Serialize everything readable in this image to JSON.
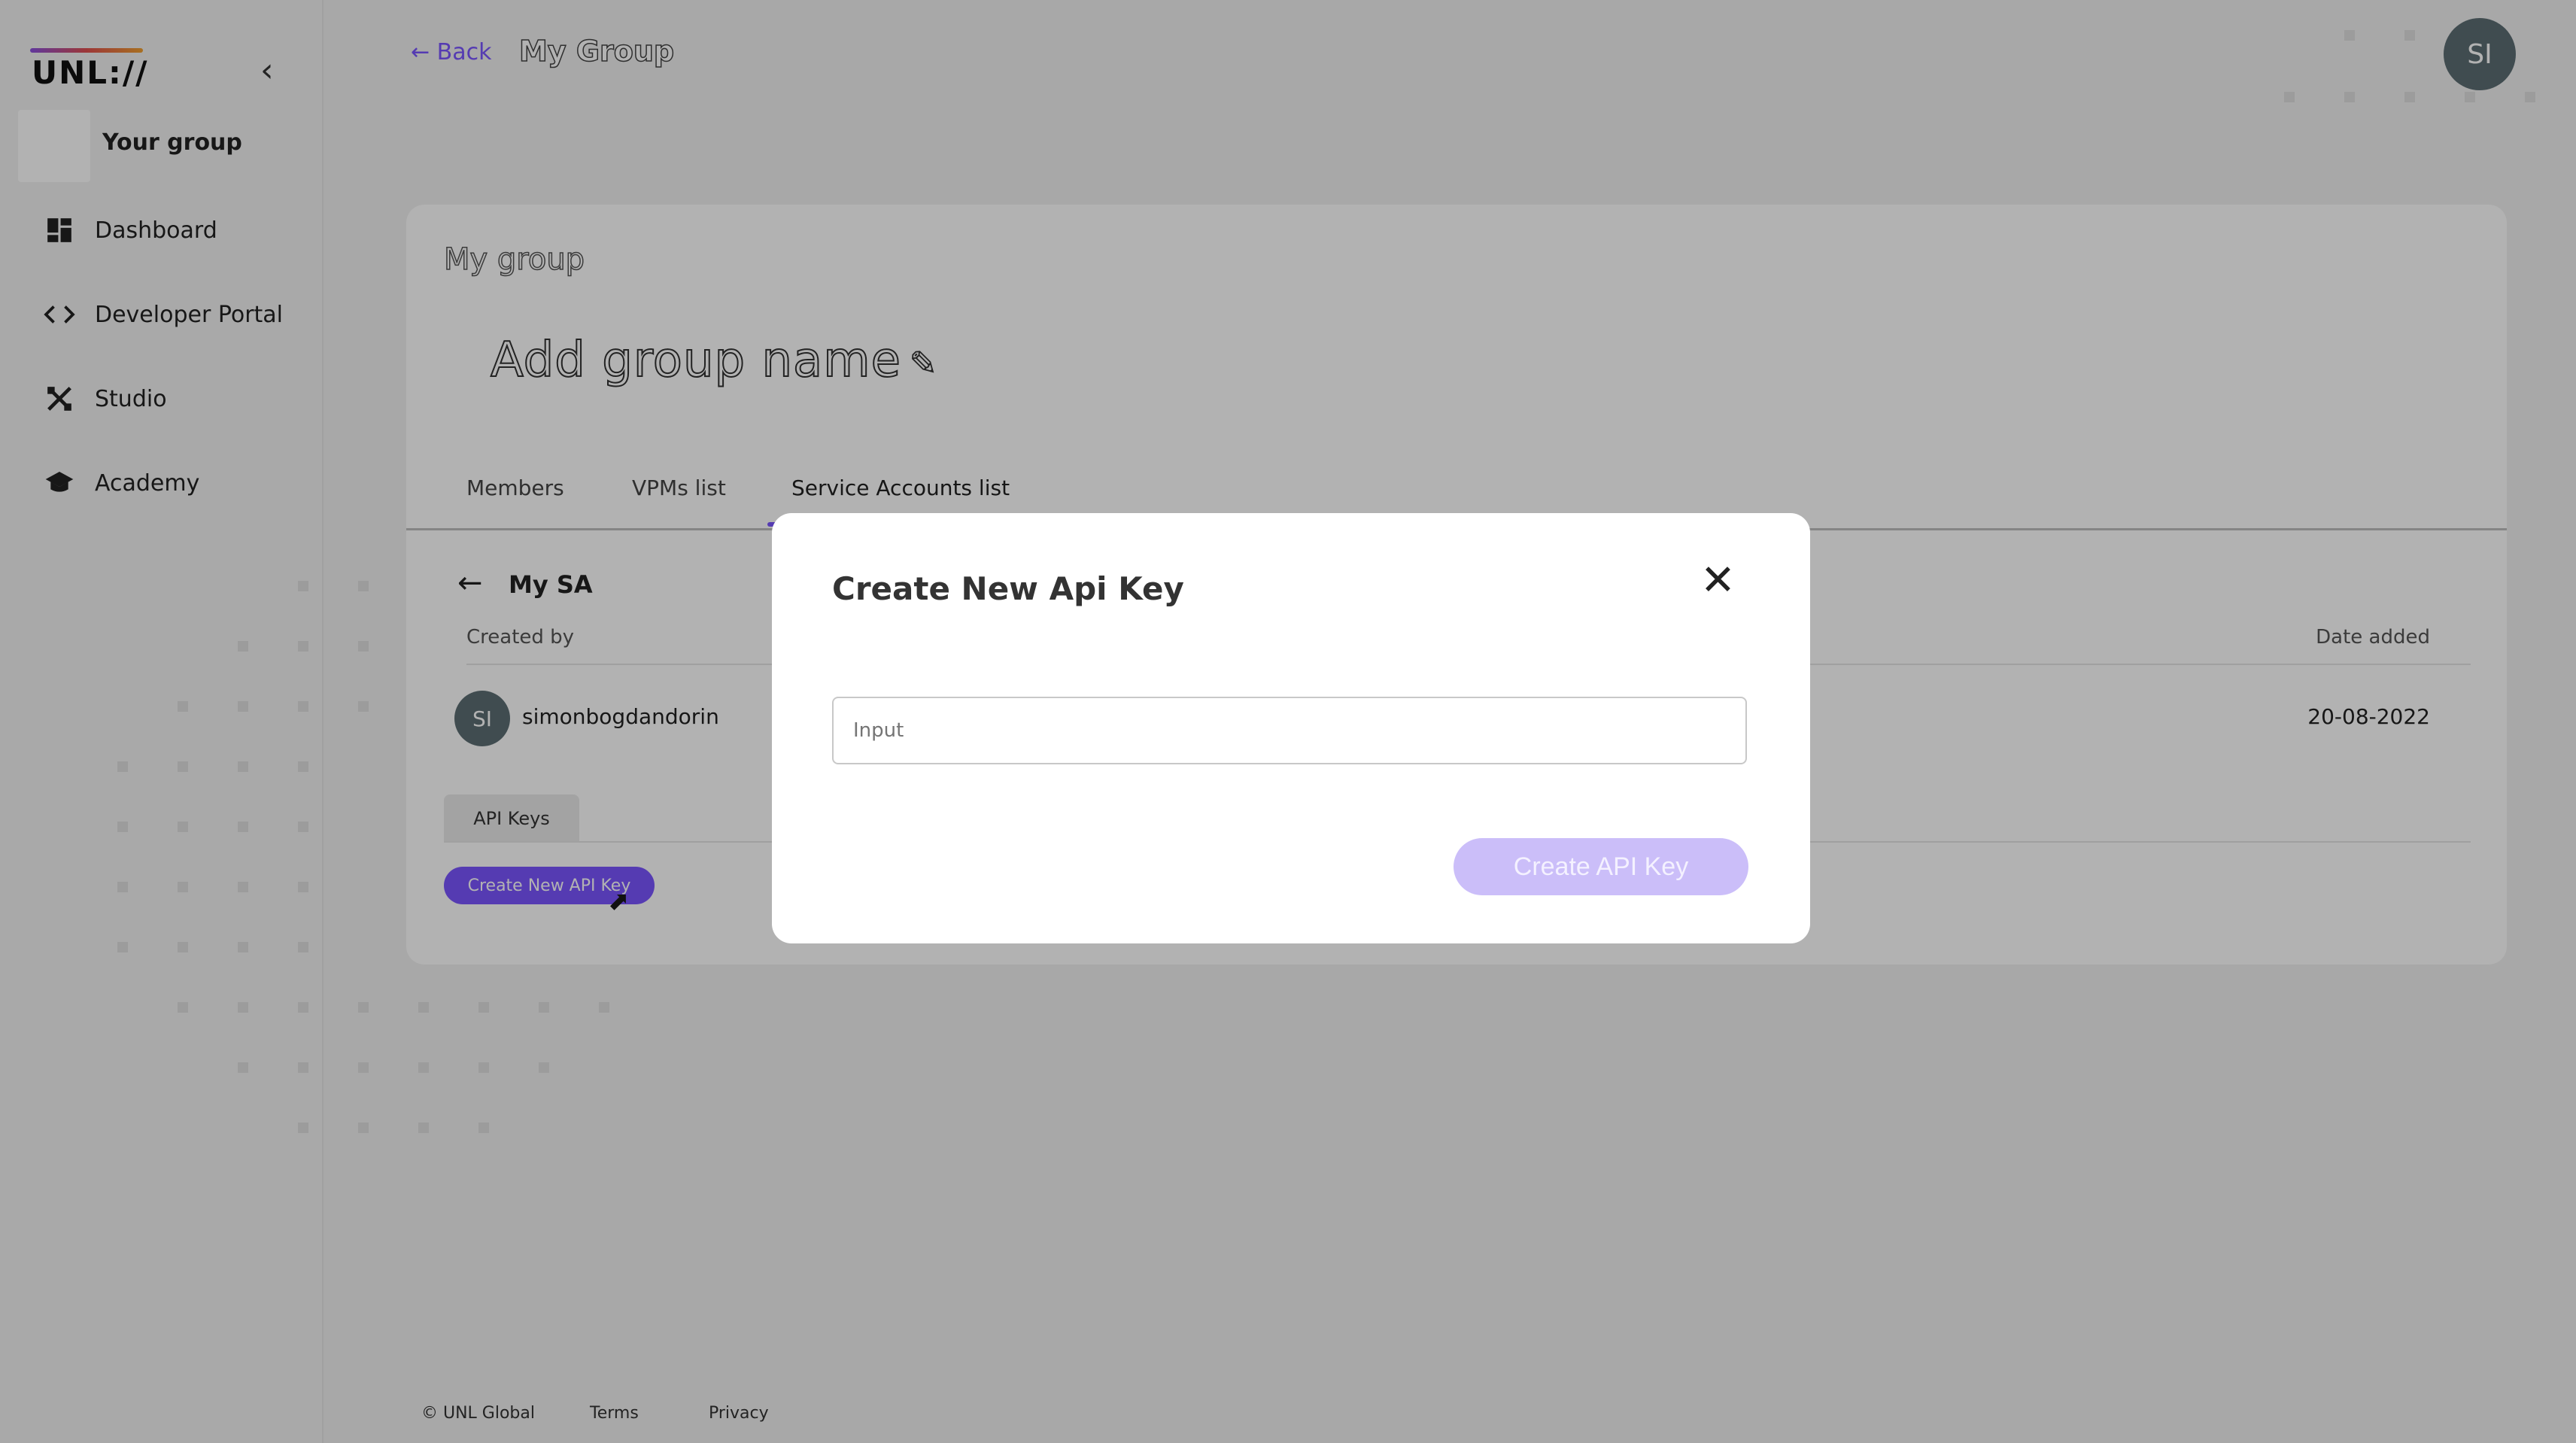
{
  "sidebar": {
    "logo": "UNL://",
    "group_label": "Your group",
    "items": [
      {
        "label": "Dashboard",
        "icon": "dashboard-icon"
      },
      {
        "label": "Developer Portal",
        "icon": "code-icon"
      },
      {
        "label": "Studio",
        "icon": "studio-icon"
      },
      {
        "label": "Academy",
        "icon": "academy-icon"
      }
    ]
  },
  "header": {
    "back_label": "← Back",
    "title": "My Group",
    "user_initials": "SI"
  },
  "card": {
    "title": "My group",
    "group_name_placeholder": "Add group name",
    "tabs": [
      "Members",
      "VPMs list",
      "Service Accounts list"
    ],
    "active_tab": "Service Accounts list",
    "sa": {
      "title": "My SA",
      "created_by_label": "Created by",
      "date_added_label": "Date added",
      "creator_initials": "SI",
      "creator_name": "simonbogdandorin",
      "date_value": "20-08-2022"
    },
    "api_keys_tab": "API Keys",
    "create_button": "Create New API Key"
  },
  "modal": {
    "title": "Create New Api Key",
    "input_placeholder": "Input",
    "submit_button": "Create API Key"
  },
  "footer": {
    "copyright": "© UNL Global",
    "terms": "Terms",
    "privacy": "Privacy"
  },
  "colors": {
    "accent": "#7a55ff",
    "overlay": "rgba(0,0,0,0.3)",
    "avatar": "#5c6e73"
  }
}
